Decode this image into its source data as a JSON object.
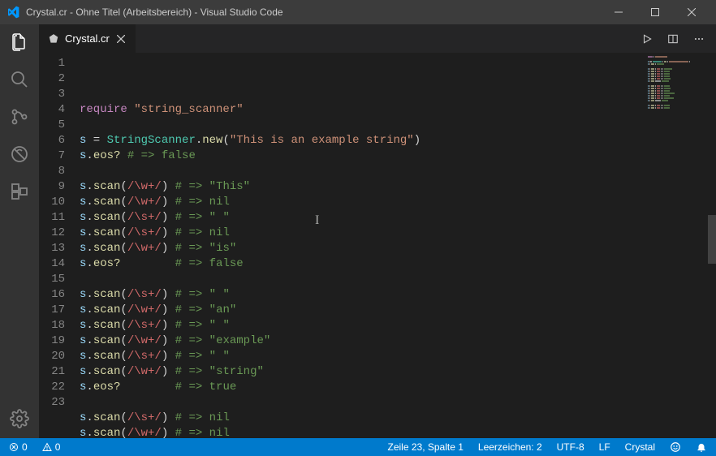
{
  "window": {
    "title": "Crystal.cr - Ohne Titel (Arbeitsbereich) - Visual Studio Code"
  },
  "tab": {
    "filename": "Crystal.cr"
  },
  "statusbar": {
    "errors": "0",
    "warnings": "0",
    "cursor": "Zeile 23, Spalte 1",
    "spaces": "Leerzeichen: 2",
    "encoding": "UTF-8",
    "eol": "LF",
    "language": "Crystal"
  },
  "code_plain": [
    "require \"string_scanner\"",
    "",
    "s = StringScanner.new(\"This is an example string\")",
    "s.eos? # => false",
    "",
    "s.scan(/\\w+/) # => \"This\"",
    "s.scan(/\\w+/) # => nil",
    "s.scan(/\\s+/) # => \" \"",
    "s.scan(/\\s+/) # => nil",
    "s.scan(/\\w+/) # => \"is\"",
    "s.eos?        # => false",
    "",
    "s.scan(/\\s+/) # => \" \"",
    "s.scan(/\\w+/) # => \"an\"",
    "s.scan(/\\s+/) # => \" \"",
    "s.scan(/\\w+/) # => \"example\"",
    "s.scan(/\\s+/) # => \" \"",
    "s.scan(/\\w+/) # => \"string\"",
    "s.eos?        # => true",
    "",
    "s.scan(/\\s+/) # => nil",
    "s.scan(/\\w+/) # => nil",
    ""
  ],
  "code": [
    [
      {
        "t": "require",
        "c": "kw"
      },
      {
        "t": " ",
        "c": ""
      },
      {
        "t": "\"string_scanner\"",
        "c": "str"
      }
    ],
    [],
    [
      {
        "t": "s",
        "c": "var"
      },
      {
        "t": " = ",
        "c": "punc"
      },
      {
        "t": "StringScanner",
        "c": "type"
      },
      {
        "t": ".",
        "c": "punc"
      },
      {
        "t": "new",
        "c": "call"
      },
      {
        "t": "(",
        "c": "punc"
      },
      {
        "t": "\"This is an example string\"",
        "c": "str"
      },
      {
        "t": ")",
        "c": "punc"
      }
    ],
    [
      {
        "t": "s",
        "c": "var"
      },
      {
        "t": ".",
        "c": "punc"
      },
      {
        "t": "eos?",
        "c": "method"
      },
      {
        "t": " ",
        "c": ""
      },
      {
        "t": "# => false",
        "c": "comment"
      }
    ],
    [],
    [
      {
        "t": "s",
        "c": "var"
      },
      {
        "t": ".",
        "c": "punc"
      },
      {
        "t": "scan",
        "c": "method"
      },
      {
        "t": "(",
        "c": "punc"
      },
      {
        "t": "/\\w+/",
        "c": "regex"
      },
      {
        "t": ")",
        "c": "punc"
      },
      {
        "t": " ",
        "c": ""
      },
      {
        "t": "# => \"This\"",
        "c": "comment"
      }
    ],
    [
      {
        "t": "s",
        "c": "var"
      },
      {
        "t": ".",
        "c": "punc"
      },
      {
        "t": "scan",
        "c": "method"
      },
      {
        "t": "(",
        "c": "punc"
      },
      {
        "t": "/\\w+/",
        "c": "regex"
      },
      {
        "t": ")",
        "c": "punc"
      },
      {
        "t": " ",
        "c": ""
      },
      {
        "t": "# => nil",
        "c": "comment"
      }
    ],
    [
      {
        "t": "s",
        "c": "var"
      },
      {
        "t": ".",
        "c": "punc"
      },
      {
        "t": "scan",
        "c": "method"
      },
      {
        "t": "(",
        "c": "punc"
      },
      {
        "t": "/\\s+/",
        "c": "regex"
      },
      {
        "t": ")",
        "c": "punc"
      },
      {
        "t": " ",
        "c": ""
      },
      {
        "t": "# => \" \"",
        "c": "comment"
      }
    ],
    [
      {
        "t": "s",
        "c": "var"
      },
      {
        "t": ".",
        "c": "punc"
      },
      {
        "t": "scan",
        "c": "method"
      },
      {
        "t": "(",
        "c": "punc"
      },
      {
        "t": "/\\s+/",
        "c": "regex"
      },
      {
        "t": ")",
        "c": "punc"
      },
      {
        "t": " ",
        "c": ""
      },
      {
        "t": "# => nil",
        "c": "comment"
      }
    ],
    [
      {
        "t": "s",
        "c": "var"
      },
      {
        "t": ".",
        "c": "punc"
      },
      {
        "t": "scan",
        "c": "method"
      },
      {
        "t": "(",
        "c": "punc"
      },
      {
        "t": "/\\w+/",
        "c": "regex"
      },
      {
        "t": ")",
        "c": "punc"
      },
      {
        "t": " ",
        "c": ""
      },
      {
        "t": "# => \"is\"",
        "c": "comment"
      }
    ],
    [
      {
        "t": "s",
        "c": "var"
      },
      {
        "t": ".",
        "c": "punc"
      },
      {
        "t": "eos?",
        "c": "method"
      },
      {
        "t": "        ",
        "c": ""
      },
      {
        "t": "# => false",
        "c": "comment"
      }
    ],
    [],
    [
      {
        "t": "s",
        "c": "var"
      },
      {
        "t": ".",
        "c": "punc"
      },
      {
        "t": "scan",
        "c": "method"
      },
      {
        "t": "(",
        "c": "punc"
      },
      {
        "t": "/\\s+/",
        "c": "regex"
      },
      {
        "t": ")",
        "c": "punc"
      },
      {
        "t": " ",
        "c": ""
      },
      {
        "t": "# => \" \"",
        "c": "comment"
      }
    ],
    [
      {
        "t": "s",
        "c": "var"
      },
      {
        "t": ".",
        "c": "punc"
      },
      {
        "t": "scan",
        "c": "method"
      },
      {
        "t": "(",
        "c": "punc"
      },
      {
        "t": "/\\w+/",
        "c": "regex"
      },
      {
        "t": ")",
        "c": "punc"
      },
      {
        "t": " ",
        "c": ""
      },
      {
        "t": "# => \"an\"",
        "c": "comment"
      }
    ],
    [
      {
        "t": "s",
        "c": "var"
      },
      {
        "t": ".",
        "c": "punc"
      },
      {
        "t": "scan",
        "c": "method"
      },
      {
        "t": "(",
        "c": "punc"
      },
      {
        "t": "/\\s+/",
        "c": "regex"
      },
      {
        "t": ")",
        "c": "punc"
      },
      {
        "t": " ",
        "c": ""
      },
      {
        "t": "# => \" \"",
        "c": "comment"
      }
    ],
    [
      {
        "t": "s",
        "c": "var"
      },
      {
        "t": ".",
        "c": "punc"
      },
      {
        "t": "scan",
        "c": "method"
      },
      {
        "t": "(",
        "c": "punc"
      },
      {
        "t": "/\\w+/",
        "c": "regex"
      },
      {
        "t": ")",
        "c": "punc"
      },
      {
        "t": " ",
        "c": ""
      },
      {
        "t": "# => \"example\"",
        "c": "comment"
      }
    ],
    [
      {
        "t": "s",
        "c": "var"
      },
      {
        "t": ".",
        "c": "punc"
      },
      {
        "t": "scan",
        "c": "method"
      },
      {
        "t": "(",
        "c": "punc"
      },
      {
        "t": "/\\s+/",
        "c": "regex"
      },
      {
        "t": ")",
        "c": "punc"
      },
      {
        "t": " ",
        "c": ""
      },
      {
        "t": "# => \" \"",
        "c": "comment"
      }
    ],
    [
      {
        "t": "s",
        "c": "var"
      },
      {
        "t": ".",
        "c": "punc"
      },
      {
        "t": "scan",
        "c": "method"
      },
      {
        "t": "(",
        "c": "punc"
      },
      {
        "t": "/\\w+/",
        "c": "regex"
      },
      {
        "t": ")",
        "c": "punc"
      },
      {
        "t": " ",
        "c": ""
      },
      {
        "t": "# => \"string\"",
        "c": "comment"
      }
    ],
    [
      {
        "t": "s",
        "c": "var"
      },
      {
        "t": ".",
        "c": "punc"
      },
      {
        "t": "eos?",
        "c": "method"
      },
      {
        "t": "        ",
        "c": ""
      },
      {
        "t": "# => true",
        "c": "comment"
      }
    ],
    [],
    [
      {
        "t": "s",
        "c": "var"
      },
      {
        "t": ".",
        "c": "punc"
      },
      {
        "t": "scan",
        "c": "method"
      },
      {
        "t": "(",
        "c": "punc"
      },
      {
        "t": "/\\s+/",
        "c": "regex"
      },
      {
        "t": ")",
        "c": "punc"
      },
      {
        "t": " ",
        "c": ""
      },
      {
        "t": "# => nil",
        "c": "comment"
      }
    ],
    [
      {
        "t": "s",
        "c": "var"
      },
      {
        "t": ".",
        "c": "punc"
      },
      {
        "t": "scan",
        "c": "method"
      },
      {
        "t": "(",
        "c": "punc"
      },
      {
        "t": "/\\w+/",
        "c": "regex"
      },
      {
        "t": ")",
        "c": "punc"
      },
      {
        "t": " ",
        "c": ""
      },
      {
        "t": "# => nil",
        "c": "comment"
      }
    ],
    []
  ]
}
